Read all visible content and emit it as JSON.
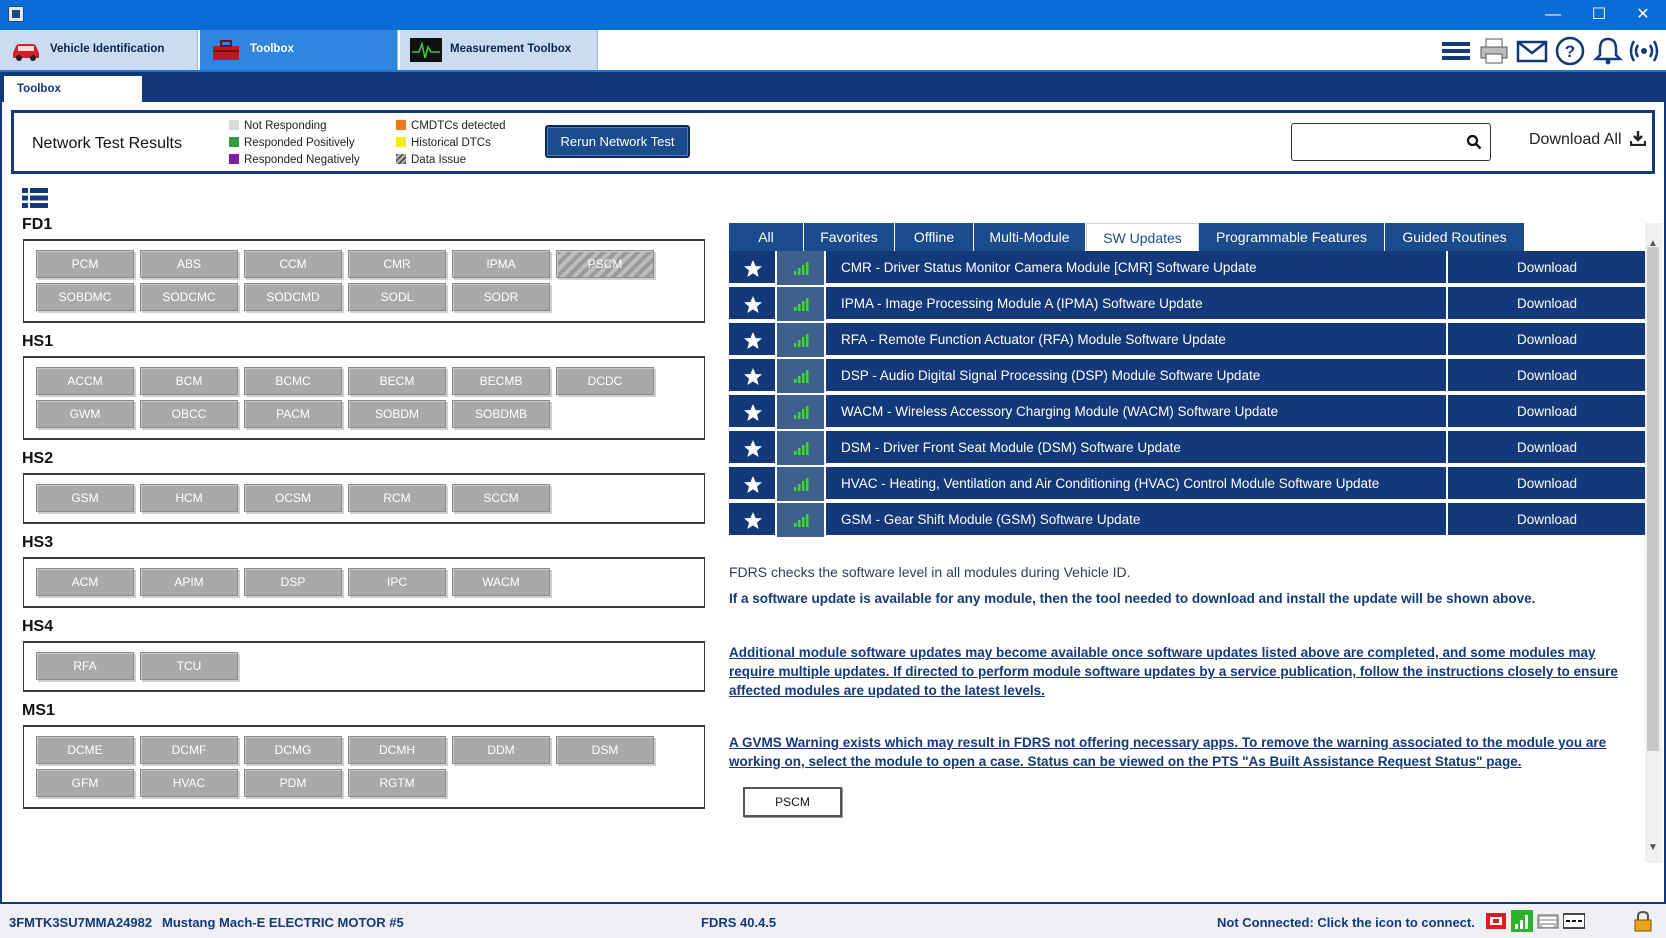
{
  "window": {
    "minimize": "—",
    "maximize": "☐",
    "close": "✕"
  },
  "app_tabs": [
    {
      "label": "Vehicle Identification",
      "icon": "car-icon"
    },
    {
      "label": "Toolbox",
      "icon": "toolbox-icon"
    },
    {
      "label": "Measurement Toolbox",
      "icon": "oscilloscope-icon"
    }
  ],
  "toolbar_icons": [
    "menu-icon",
    "printer-icon",
    "mail-icon",
    "help-icon",
    "bell-icon",
    "wireless-icon"
  ],
  "sub_tab": "Toolbox",
  "network": {
    "title": "Network Test Results",
    "legend": [
      {
        "label": "Not Responding",
        "color": "#d9d9d9"
      },
      {
        "label": "Responded Positively",
        "color": "#2e9e3e"
      },
      {
        "label": "Responded Negatively",
        "color": "#7a1fa2"
      },
      {
        "label": "CMDTCs detected",
        "color": "#f07818"
      },
      {
        "label": "Historical DTCs",
        "color": "#f2ec1c"
      },
      {
        "label": "Data Issue",
        "color": "hatched"
      }
    ],
    "rerun": "Rerun Network Test",
    "search_value": "",
    "download_all": "Download All"
  },
  "groups": [
    {
      "name": "FD1",
      "modules": [
        "PCM",
        "ABS",
        "CCM",
        "CMR",
        "IPMA",
        "PSCM",
        "SOBDMC",
        "SODCMC",
        "SODCMD",
        "SODL",
        "SODR"
      ]
    },
    {
      "name": "HS1",
      "modules": [
        "ACCM",
        "BCM",
        "BCMC",
        "BECM",
        "BECMB",
        "DCDC",
        "GWM",
        "OBCC",
        "PACM",
        "SOBDM",
        "SOBDMB"
      ]
    },
    {
      "name": "HS2",
      "modules": [
        "GSM",
        "HCM",
        "OCSM",
        "RCM",
        "SCCM"
      ]
    },
    {
      "name": "HS3",
      "modules": [
        "ACM",
        "APIM",
        "DSP",
        "IPC",
        "WACM"
      ]
    },
    {
      "name": "HS4",
      "modules": [
        "RFA",
        "TCU"
      ]
    },
    {
      "name": "MS1",
      "modules": [
        "DCME",
        "DCMF",
        "DCMG",
        "DCMH",
        "DDM",
        "DSM",
        "GFM",
        "HVAC",
        "PDM",
        "RGTM"
      ]
    }
  ],
  "right_tabs": [
    "All",
    "Favorites",
    "Offline",
    "Multi-Module",
    "SW Updates",
    "Programmable Features",
    "Guided Routines"
  ],
  "active_right_tab": "SW Updates",
  "sw_updates": [
    {
      "title": "CMR - Driver Status Monitor Camera Module [CMR] Software Update",
      "action": "Download"
    },
    {
      "title": "IPMA - Image Processing Module A (IPMA) Software Update",
      "action": "Download"
    },
    {
      "title": "RFA - Remote Function Actuator (RFA) Module Software Update",
      "action": "Download"
    },
    {
      "title": "DSP - Audio Digital Signal Processing (DSP) Module Software Update",
      "action": "Download"
    },
    {
      "title": "WACM - Wireless Accessory Charging Module (WACM) Software Update",
      "action": "Download"
    },
    {
      "title": "DSM - Driver Front Seat Module (DSM) Software Update",
      "action": "Download"
    },
    {
      "title": "HVAC - Heating, Ventilation and Air Conditioning (HVAC) Control Module Software Update",
      "action": "Download"
    },
    {
      "title": "GSM - Gear Shift Module (GSM) Software Update",
      "action": "Download"
    }
  ],
  "info": {
    "line1": "FDRS checks the software level in all modules during Vehicle ID.",
    "line2": "If a software update is available for any module, then the tool needed to download and install the update will be shown above.",
    "para1": "Additional module software updates may become available once software updates listed above are completed, and some modules may require multiple updates. If directed to perform module software updates by a service publication, follow the instructions closely to ensure affected modules are updated to the latest levels.",
    "para2": "A GVMS Warning exists which may result in FDRS not offering necessary apps. To remove the warning associated to the module you are working on, select the module to open a case. Status can be viewed on the PTS \"As Built Assistance Request Status\" page.",
    "pscm_button": "PSCM"
  },
  "status": {
    "vin": "3FMTK3SU7MMA24982",
    "vehicle": "Mustang Mach-E ELECTRIC MOTOR #5",
    "version": "FDRS 40.4.5",
    "connection": "Not Connected: Click the icon to connect."
  }
}
